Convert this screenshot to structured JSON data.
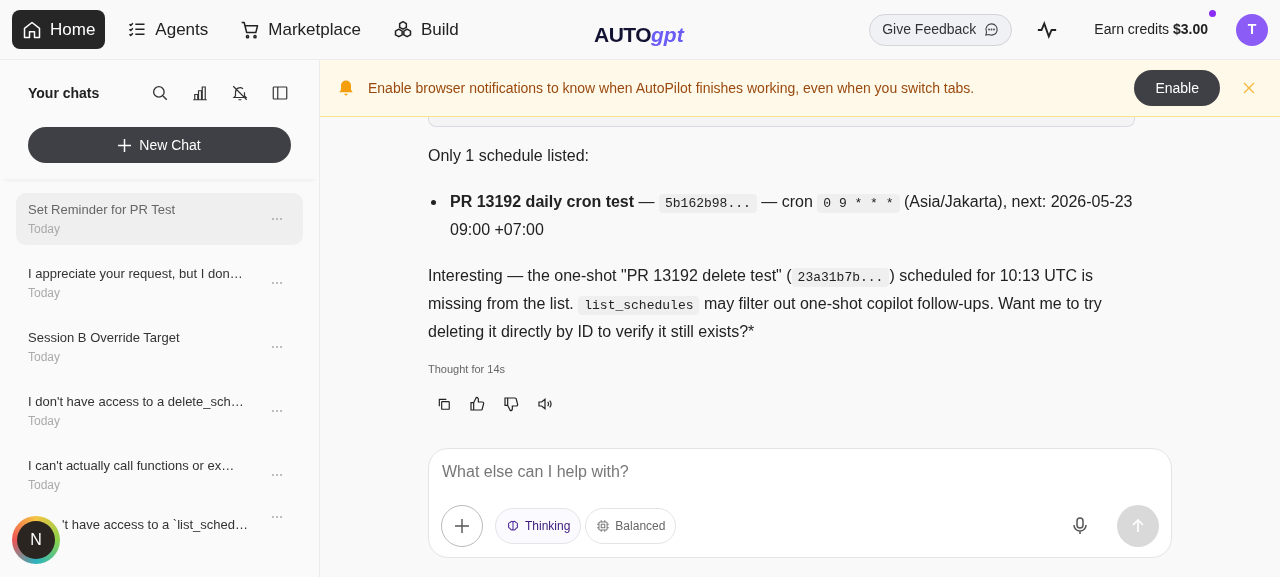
{
  "nav": {
    "tabs": [
      {
        "label": "Home",
        "selected": true
      },
      {
        "label": "Agents",
        "selected": false
      },
      {
        "label": "Marketplace",
        "selected": false
      },
      {
        "label": "Build",
        "selected": false
      }
    ],
    "logo": {
      "part_1": "AUTO",
      "part_2": "gpt"
    },
    "feedback_button": "Give Feedback",
    "credits": {
      "label": "Earn credits",
      "amount": "$3.00",
      "unread": true
    },
    "avatar": "T"
  },
  "sidebar": {
    "title": "Your chats",
    "new_chat": "New Chat",
    "chats": [
      {
        "title": "Set Reminder for PR Test",
        "date": "Today",
        "selected": true,
        "kind": "normal"
      },
      {
        "title": "I appreciate your request, but I don…",
        "date": "Today",
        "selected": false,
        "kind": "normal"
      },
      {
        "title": "Session B Override Target",
        "date": "Today",
        "selected": false,
        "kind": "normal"
      },
      {
        "title": "I don't have access to a delete_sch…",
        "date": "Today",
        "selected": false,
        "kind": "normal"
      },
      {
        "title": "I can't actually call functions or ex…",
        "date": "Today",
        "selected": false,
        "kind": "normal"
      },
      {
        "title": "'t have access to a `list_sched…",
        "selected": false,
        "kind": "covered"
      }
    ],
    "floating_badge": "N"
  },
  "banner": {
    "text": "Enable browser notifications to know when AutoPilot finishes working, even when you switch tabs.",
    "button": "Enable"
  },
  "message": {
    "paragraphs": [
      {
        "kind": "plain",
        "segments": [
          {
            "kind": "text",
            "text": "Only 1 schedule listed:"
          }
        ]
      },
      {
        "kind": "bullet",
        "segments": [
          {
            "kind": "text",
            "text": "**PR 13192 daily cron test** — "
          },
          {
            "kind": "code",
            "text": "5b162b98..."
          },
          {
            "kind": "text",
            "text": " — cron "
          },
          {
            "kind": "code",
            "text": "0 9 * * *"
          },
          {
            "kind": "text",
            "text": " (Asia/Jakarta), next: 2026-05-23 09:00 +07:00"
          }
        ]
      },
      {
        "kind": "plain",
        "segments": [
          {
            "kind": "text",
            "text": "Interesting — the one-shot \"PR 13192 delete test\" ("
          },
          {
            "kind": "code",
            "text": "23a31b7b..."
          },
          {
            "kind": "text",
            "text": ") scheduled for 10:13 UTC is missing from the list. "
          },
          {
            "kind": "code",
            "text": "list_schedules"
          },
          {
            "kind": "text",
            "text": " may filter out one-shot copilot follow-ups. Want me to try deleting it directly by ID to verify it still exists?*"
          }
        ]
      }
    ],
    "thought": "Thought for 14s"
  },
  "composer": {
    "placeholder": "What else can I help with?",
    "chips": [
      {
        "label": "Thinking",
        "selected": true
      },
      {
        "label": "Balanced",
        "selected": false
      }
    ]
  }
}
